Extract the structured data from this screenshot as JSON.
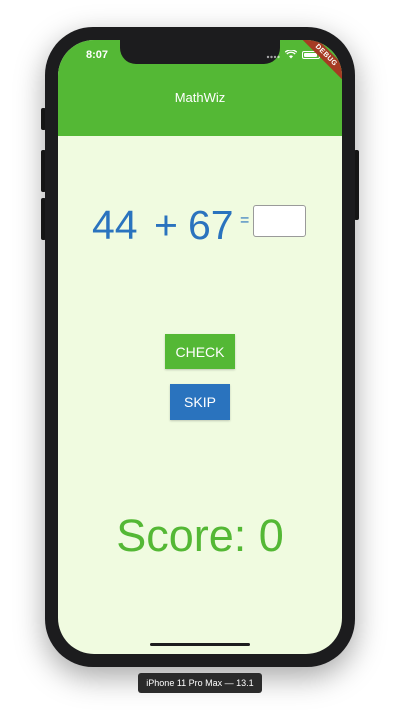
{
  "status_bar": {
    "time": "8:07",
    "icons": [
      "signal-icon",
      "wifi-icon",
      "battery-icon"
    ]
  },
  "debug_banner": "DEBUG",
  "app_bar": {
    "title": "MathWiz",
    "color": "#54b835"
  },
  "equation": {
    "operand1": "44",
    "operator": "+",
    "operand2": "67",
    "equals": "=",
    "answer_value": "",
    "color": "#2a73be"
  },
  "buttons": {
    "check_label": "CHECK",
    "skip_label": "SKIP",
    "check_color": "#54b835",
    "skip_color": "#2a73be"
  },
  "score": {
    "text": "Score: 0"
  },
  "device": {
    "label": "iPhone 11 Pro Max — 13.1"
  },
  "colors": {
    "background": "#f0fbe0",
    "phone_frame": "#1c1c1e"
  }
}
